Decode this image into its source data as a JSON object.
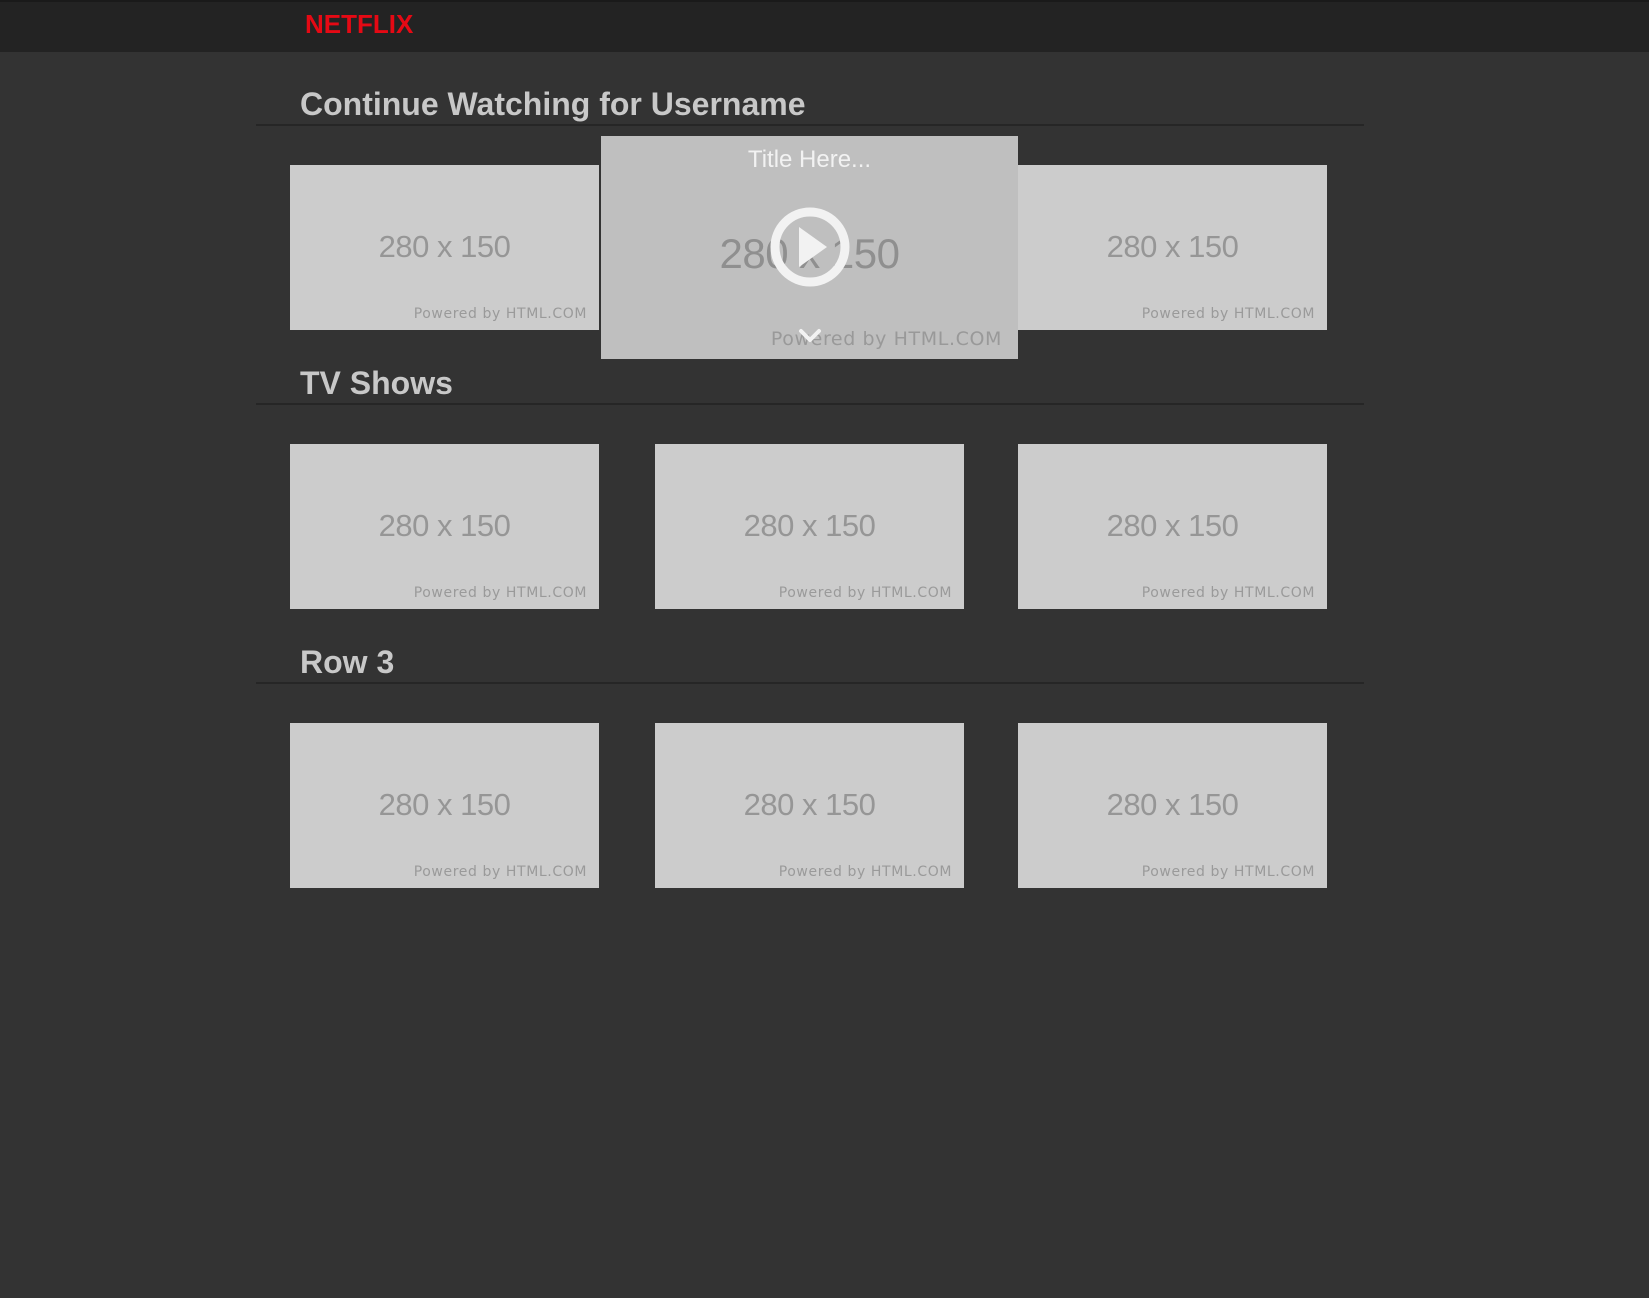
{
  "header": {
    "logo": "NETFLIX",
    "brand_color": "#e50914"
  },
  "rows": [
    {
      "title": "Continue Watching for Username",
      "tiles": [
        {
          "size_label": "280 x 150",
          "powered": "Powered by HTML.COM"
        },
        {
          "size_label": "280 x 150",
          "powered": "Powered by HTML.COM",
          "hovered": true,
          "overlay_title": "Title Here...",
          "icons": [
            "play-icon",
            "chevron-down-icon"
          ]
        },
        {
          "size_label": "280 x 150",
          "powered": "Powered by HTML.COM"
        }
      ]
    },
    {
      "title": "TV Shows",
      "tiles": [
        {
          "size_label": "280 x 150",
          "powered": "Powered by HTML.COM"
        },
        {
          "size_label": "280 x 150",
          "powered": "Powered by HTML.COM"
        },
        {
          "size_label": "280 x 150",
          "powered": "Powered by HTML.COM"
        }
      ]
    },
    {
      "title": "Row 3",
      "tiles": [
        {
          "size_label": "280 x 150",
          "powered": "Powered by HTML.COM"
        },
        {
          "size_label": "280 x 150",
          "powered": "Powered by HTML.COM"
        },
        {
          "size_label": "280 x 150",
          "powered": "Powered by HTML.COM"
        }
      ]
    }
  ]
}
